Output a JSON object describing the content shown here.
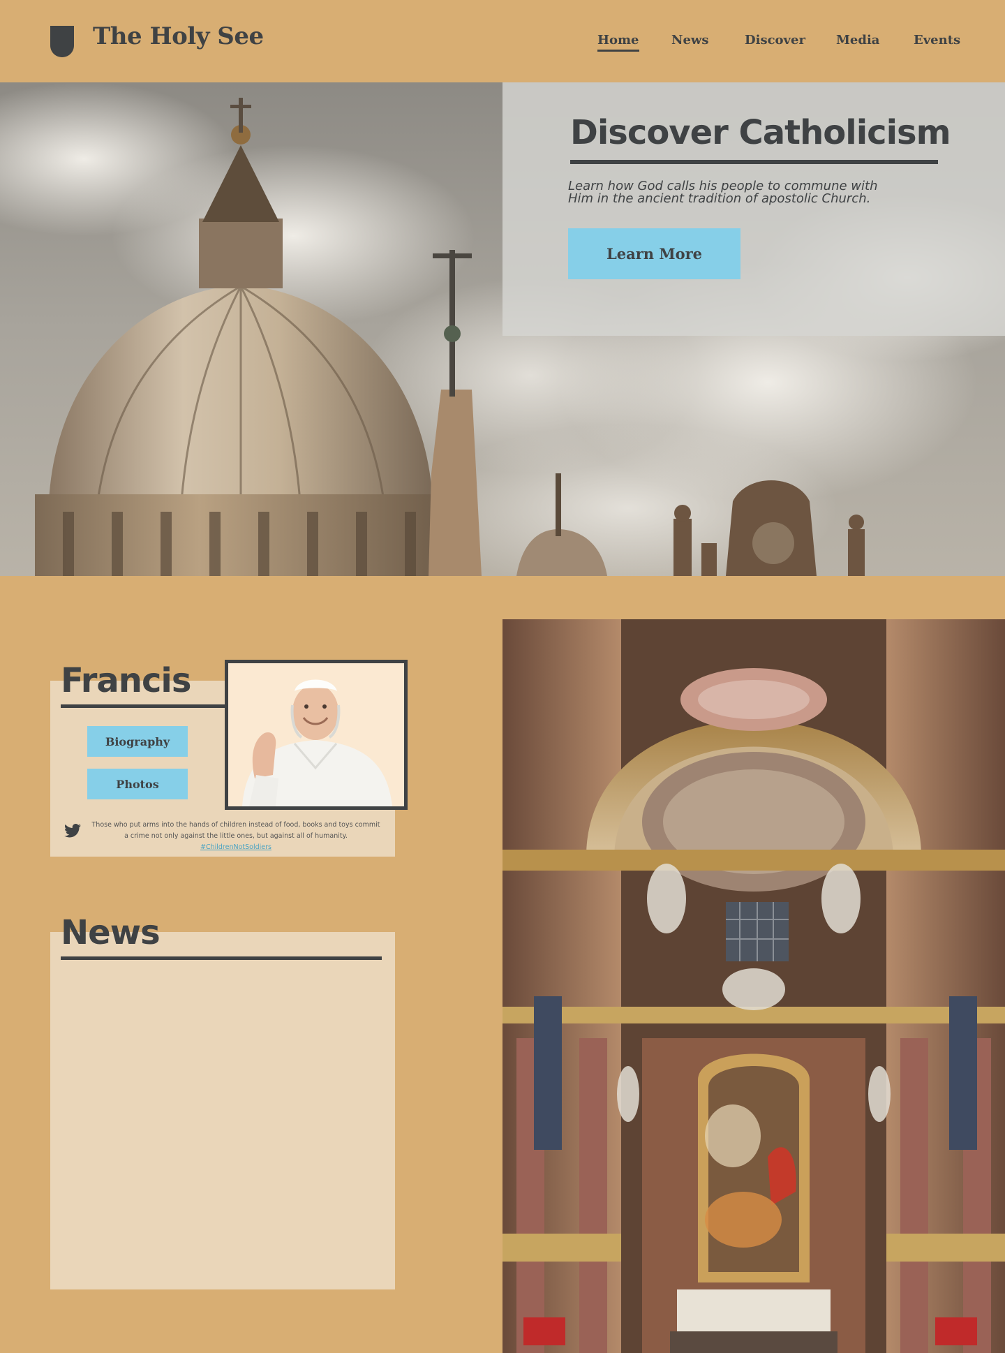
{
  "site": {
    "title": "The Holy See",
    "logo_icon": "shield-icon"
  },
  "nav": {
    "items": [
      {
        "label": "Home",
        "active": true
      },
      {
        "label": "News",
        "active": false
      },
      {
        "label": "Discover",
        "active": false
      },
      {
        "label": "Media",
        "active": false
      },
      {
        "label": "Events",
        "active": false
      }
    ]
  },
  "hero": {
    "heading": "Discover Catholicism",
    "text": "Learn how God calls his people to commune with Him in the ancient tradition of apostolic Church.",
    "button_label": "Learn More"
  },
  "francis": {
    "title": "Francis",
    "buttons": [
      "Biography",
      "Photos"
    ],
    "tweet_icon": "twitter-bird-icon",
    "tweet_text": "Those who put arms into the hands of children instead of food, books and toys commit a crime not only against the little ones, but against all of humanity.",
    "tweet_hashtag": "#ChildrenNotSoldiers"
  },
  "news": {
    "title": "News"
  },
  "colors": {
    "background": "#d8ae73",
    "card": "#ead6b9",
    "accent_button": "#86cfe8",
    "text_dark": "#3f4244",
    "link": "#4aa3c3"
  }
}
